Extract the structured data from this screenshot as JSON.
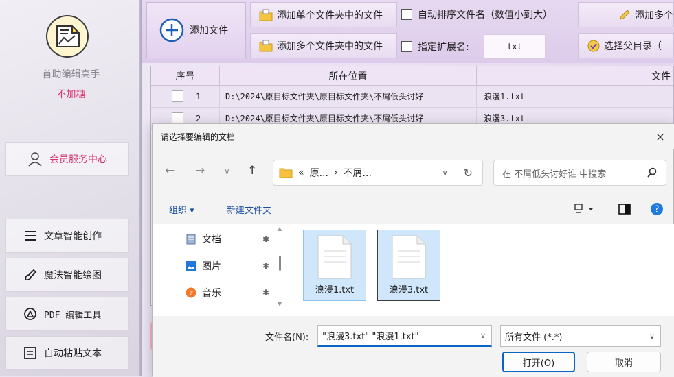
{
  "sidebar": {
    "app_name": "首助编辑高手",
    "app_subtitle": "不加糖",
    "member_center": "会员服务中心",
    "nav": [
      {
        "label": "文章智能创作"
      },
      {
        "label": "魔法智能绘图"
      },
      {
        "label": "PDF 编辑工具"
      },
      {
        "label": "自动粘贴文本"
      }
    ]
  },
  "toolbar": {
    "add_file": "添加文件",
    "add_single_folder": "添加单个文件夹中的文件",
    "add_multi_folder": "添加多个文件夹中的文件",
    "auto_sort": "自动排序文件名（数值小到大）",
    "specify_ext": "指定扩展名:",
    "ext_value": "txt",
    "add_multi_right": "添加多个",
    "select_parent": "选择父目录（"
  },
  "table": {
    "headers": [
      "序号",
      "所在位置",
      "文件"
    ],
    "rows": [
      {
        "no": "1",
        "location": "D:\\2024\\原目标文件夹\\原目标文件夹\\不屑低头讨好",
        "file": "浪漫1.txt"
      },
      {
        "no": "2",
        "location": "D:\\2024\\原目标文件夹\\原目标文件夹\\不屑低头讨好",
        "file": "浪漫3.txt"
      }
    ]
  },
  "dialog": {
    "title": "请选择要编辑的文档",
    "close": "×",
    "breadcrumb": [
      "«",
      "原...",
      "›",
      "不屑..."
    ],
    "search_placeholder": "在 不屑低头讨好谁 中搜索",
    "organize": "组织 ▾",
    "new_folder": "新建文件夹",
    "quick_access": [
      {
        "label": "文档",
        "icon": "document-icon"
      },
      {
        "label": "图片",
        "icon": "picture-icon"
      },
      {
        "label": "音乐",
        "icon": "music-icon"
      }
    ],
    "files": [
      {
        "name": "浪漫1.txt"
      },
      {
        "name": "浪漫3.txt"
      }
    ],
    "filename_label": "文件名(N):",
    "filename_value": "\"浪漫3.txt\" \"浪漫1.txt\"",
    "filetype": "所有文件 (*.*)",
    "open": "打开(O)",
    "cancel": "取消"
  },
  "colors": {
    "accent_pink": "#d6336c",
    "windows_blue": "#0a64c8",
    "selection": "#cfe6fb"
  }
}
